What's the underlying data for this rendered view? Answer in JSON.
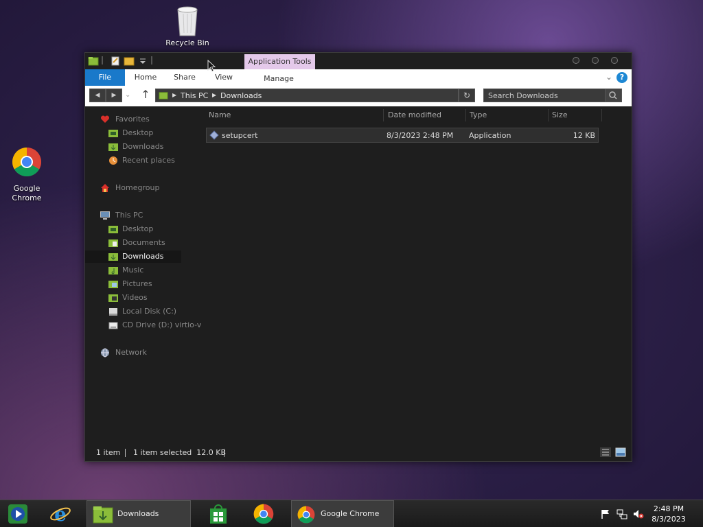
{
  "desktop": {
    "recycle_bin_label": "Recycle Bin",
    "chrome_label": "Google Chrome"
  },
  "window": {
    "contextual_tab_group": "Application Tools",
    "ribbon_tabs": {
      "file": "File",
      "home": "Home",
      "share": "Share",
      "view": "View",
      "manage": "Manage"
    },
    "help": "?"
  },
  "address_bar": {
    "crumbs": [
      "This PC",
      "Downloads"
    ],
    "search_placeholder": "Search Downloads"
  },
  "nav_pane": {
    "favorites": "Favorites",
    "fav_desktop": "Desktop",
    "fav_downloads": "Downloads",
    "fav_recent": "Recent places",
    "homegroup": "Homegroup",
    "this_pc": "This PC",
    "pc_desktop": "Desktop",
    "pc_documents": "Documents",
    "pc_downloads": "Downloads",
    "pc_music": "Music",
    "pc_pictures": "Pictures",
    "pc_videos": "Videos",
    "pc_local_disk": "Local Disk (C:)",
    "pc_cd_drive": "CD Drive (D:) virtio-v",
    "network": "Network",
    "selected": "pc_downloads"
  },
  "file_list": {
    "columns": {
      "name": "Name",
      "date": "Date modified",
      "type": "Type",
      "size": "Size"
    },
    "rows": [
      {
        "name": "setupcert",
        "date": "8/3/2023 2:48 PM",
        "type": "Application",
        "size": "12 KB"
      }
    ]
  },
  "status_bar": {
    "item_count": "1 item",
    "selection": "1 item selected  12.0 KB"
  },
  "taskbar": {
    "explorer_label": "Downloads",
    "chrome_label": "Google Chrome",
    "time": "2:48 PM",
    "date": "8/3/2023"
  },
  "colors": {
    "accent": "#1979ca",
    "contextual_tab": "#e4c9ea",
    "folder": "#8bbd3a"
  }
}
